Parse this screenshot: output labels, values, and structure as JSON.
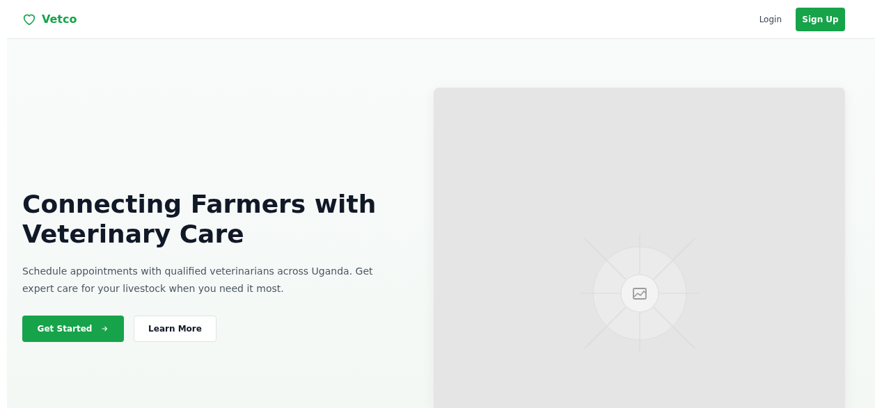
{
  "header": {
    "brand": "Vetco",
    "nav": [
      {
        "label": "Login",
        "kind": "link"
      },
      {
        "label": "Sign Up",
        "kind": "primary"
      }
    ]
  },
  "hero": {
    "title": "Connecting Farmers with Veterinary Care",
    "subtitle": "Schedule appointments with qualified veterinarians across Uganda. Get expert care for your livestock when you need it most.",
    "buttons": [
      {
        "label": "Get Started",
        "kind": "primary"
      },
      {
        "label": "Learn More",
        "kind": "secondary"
      }
    ],
    "image": {
      "kind": "placeholder"
    }
  }
}
